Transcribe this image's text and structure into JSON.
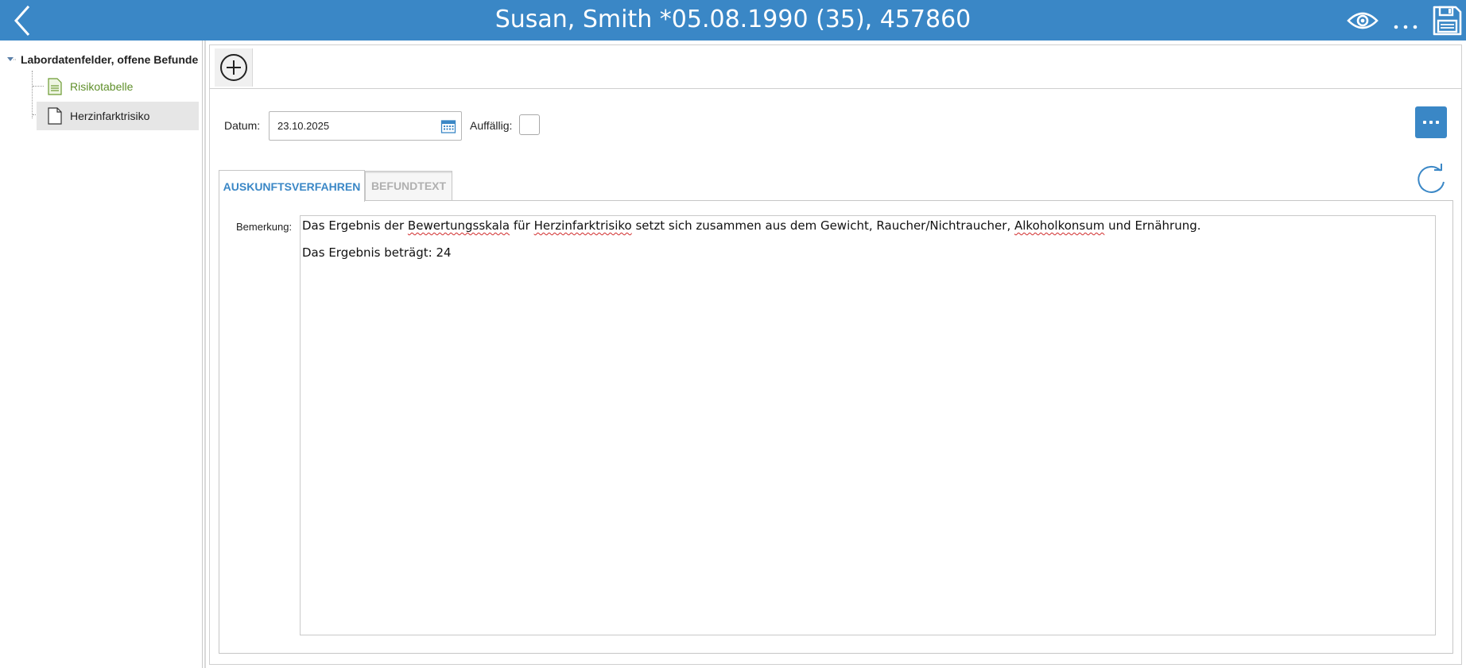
{
  "header": {
    "title": "Susan, Smith *05.08.1990 (35), 457860"
  },
  "sidebar": {
    "root_label": "Labordatenfelder, offene Befunde",
    "items": [
      {
        "label": "Risikotabelle"
      },
      {
        "label": "Herzinfarktrisiko"
      }
    ]
  },
  "form": {
    "date_label": "Datum:",
    "date_value": "23.10.2025",
    "abnormal_label": "Auffällig:",
    "abnormal_checked": false
  },
  "tabs": [
    {
      "label": "AUSKUNFTSVERFAHREN",
      "active": true
    },
    {
      "label": "BEFUNDTEXT",
      "active": false
    }
  ],
  "remark": {
    "label": "Bemerkung:",
    "line1": {
      "t1": "Das Ergebnis der ",
      "w1": "Bewertungsskala",
      "t2": " für ",
      "w2": "Herzinfarktrisiko",
      "t3": " setzt sich zusammen aus dem Gewicht, Raucher/Nichtraucher, ",
      "w3": "Alkoholkonsum",
      "t4": " und Ernährung."
    },
    "line2": "Das Ergebnis beträgt: 24"
  },
  "colors": {
    "accent": "#3a87c6",
    "risk_item": "#5f8f2a",
    "spellcheck": "#d12b2b"
  },
  "icons": {
    "header": [
      "chevron-left-icon",
      "eye-icon",
      "more-icon",
      "save-icon"
    ],
    "toolbar": [
      "add-circle-icon"
    ],
    "form": [
      "calendar-icon",
      "more-icon",
      "refresh-icon"
    ],
    "tree": [
      "caret-down-icon",
      "document-table-icon",
      "document-icon"
    ]
  }
}
